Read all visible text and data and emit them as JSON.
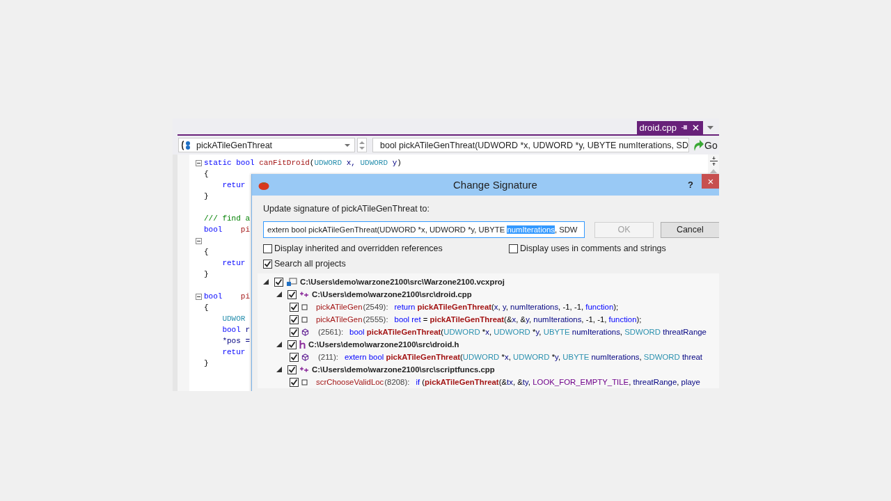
{
  "editor_tab": {
    "label": "droid.cpp",
    "selected": true
  },
  "nav_bar": {
    "scope": "pickATileGenThreat",
    "member": "bool pickATileGenThreat(UDWORD *x, UDWORD *y, UBYTE numIterations, SD",
    "go_button": "Go"
  },
  "code_lines": [
    {
      "fold": true,
      "segments": [
        {
          "text": "static bool ",
          "kind": "kw"
        },
        {
          "text": "canFitDroid",
          "kind": "fn"
        },
        {
          "text": "(",
          "kind": "plain"
        },
        {
          "text": "UDWORD",
          "kind": "type"
        },
        {
          "text": " x, ",
          "kind": "ident"
        },
        {
          "text": "UDWORD",
          "kind": "type"
        },
        {
          "text": " y",
          "kind": "ident"
        },
        {
          "text": ")",
          "kind": "plain"
        }
      ]
    },
    {
      "fold": false,
      "segments": [
        {
          "text": "{",
          "kind": "plain"
        }
      ]
    },
    {
      "fold": false,
      "segments": [
        {
          "text": "    retur",
          "kind": "kw"
        }
      ]
    },
    {
      "fold": false,
      "segments": [
        {
          "text": "}",
          "kind": "plain"
        }
      ]
    },
    {
      "fold": false
    },
    {
      "fold": false,
      "segments": [
        {
          "text": "/// find a",
          "kind": "comment"
        }
      ]
    },
    {
      "fold": false,
      "segments": [
        {
          "text": "bool    ",
          "kind": "kw"
        },
        {
          "text": "pi",
          "kind": "fn"
        }
      ]
    },
    {
      "fold": true
    },
    {
      "fold": false,
      "segments": [
        {
          "text": "{",
          "kind": "plain"
        }
      ]
    },
    {
      "fold": false,
      "segments": [
        {
          "text": "    retur",
          "kind": "kw"
        }
      ]
    },
    {
      "fold": false,
      "segments": [
        {
          "text": "}",
          "kind": "plain"
        }
      ]
    },
    {
      "fold": false
    },
    {
      "fold": true,
      "segments": [
        {
          "text": "bool    ",
          "kind": "kw"
        },
        {
          "text": "pi",
          "kind": "fn"
        }
      ]
    },
    {
      "fold": false,
      "segments": [
        {
          "text": "{",
          "kind": "plain"
        }
      ]
    },
    {
      "fold": false,
      "segments": [
        {
          "text": "    UDWOR",
          "kind": "type"
        }
      ]
    },
    {
      "fold": false,
      "segments": [
        {
          "text": "    bool ",
          "kind": "kw"
        },
        {
          "text": "r",
          "kind": "ident"
        }
      ]
    },
    {
      "fold": false,
      "segments": [
        {
          "text": "    *pos =",
          "kind": "ident"
        }
      ]
    },
    {
      "fold": false,
      "segments": [
        {
          "text": "    retur",
          "kind": "kw"
        }
      ]
    },
    {
      "fold": false,
      "segments": [
        {
          "text": "}",
          "kind": "plain"
        }
      ]
    }
  ],
  "dialog": {
    "title": "Change Signature",
    "help": "?",
    "close": "×",
    "prompt": "Update signature of pickATileGenThreat to:",
    "signature_parts": [
      {
        "text": "extern bool pickATileGenThreat(UDWORD *x, UDWORD *y, UBYTE ",
        "selected": false
      },
      {
        "text": "numIterations",
        "selected": true
      },
      {
        "text": ", SDW",
        "selected": false
      }
    ],
    "ok_button": {
      "label": "OK",
      "disabled": true
    },
    "cancel_button": {
      "label": "Cancel",
      "disabled": false
    },
    "options": [
      {
        "label": "Display inherited and overridden references",
        "checked": false
      },
      {
        "label": "Display uses in comments and strings",
        "checked": false
      },
      {
        "label": "Search all projects",
        "checked": true
      }
    ],
    "tree": [
      {
        "kind": "project",
        "label": "C:\\Users\\demo\\warzone2100\\src\\Warzone2100.vcxproj",
        "expanded": true,
        "checked": true,
        "children": [
          {
            "kind": "cpp",
            "label": "C:\\Users\\demo\\warzone2100\\src\\droid.cpp",
            "expanded": true,
            "checked": true,
            "children": [
              {
                "kind": "method",
                "scope": "pickATileGen",
                "line": "(2549):",
                "checked": true,
                "code": [
                  {
                    "text": "return ",
                    "kind": "kw"
                  },
                  {
                    "text": "pickATileGenThreat",
                    "kind": "call"
                  },
                  {
                    "text": "(",
                    "kind": "plain"
                  },
                  {
                    "text": "x",
                    "kind": "ident"
                  },
                  {
                    "text": ", ",
                    "kind": "plain"
                  },
                  {
                    "text": "y",
                    "kind": "ident"
                  },
                  {
                    "text": ", ",
                    "kind": "plain"
                  },
                  {
                    "text": "numIterations",
                    "kind": "ident"
                  },
                  {
                    "text": ", -1, -1, ",
                    "kind": "plain"
                  },
                  {
                    "text": "function",
                    "kind": "kw"
                  },
                  {
                    "text": ");",
                    "kind": "plain"
                  }
                ]
              },
              {
                "kind": "method",
                "scope": "pickATileGen",
                "line": "(2555):",
                "checked": true,
                "code": [
                  {
                    "text": "bool ",
                    "kind": "kw"
                  },
                  {
                    "text": "ret",
                    "kind": "kw"
                  },
                  {
                    "text": " = ",
                    "kind": "plain"
                  },
                  {
                    "text": "pickATileGenThreat",
                    "kind": "call"
                  },
                  {
                    "text": "(&",
                    "kind": "plain"
                  },
                  {
                    "text": "x",
                    "kind": "ident"
                  },
                  {
                    "text": ", &",
                    "kind": "plain"
                  },
                  {
                    "text": "y",
                    "kind": "ident"
                  },
                  {
                    "text": ", ",
                    "kind": "plain"
                  },
                  {
                    "text": "numIterations",
                    "kind": "ident"
                  },
                  {
                    "text": ", -1, -1, ",
                    "kind": "plain"
                  },
                  {
                    "text": "function",
                    "kind": "kw"
                  },
                  {
                    "text": ");",
                    "kind": "plain"
                  }
                ]
              },
              {
                "kind": "declaration",
                "line": "(2561):",
                "checked": true,
                "code": [
                  {
                    "text": "bool ",
                    "kind": "kw"
                  },
                  {
                    "text": "pickATileGenThreat",
                    "kind": "call"
                  },
                  {
                    "text": "(",
                    "kind": "plain"
                  },
                  {
                    "text": "UDWORD",
                    "kind": "type"
                  },
                  {
                    "text": " *",
                    "kind": "plain"
                  },
                  {
                    "text": "x",
                    "kind": "ident"
                  },
                  {
                    "text": ", ",
                    "kind": "plain"
                  },
                  {
                    "text": "UDWORD",
                    "kind": "type"
                  },
                  {
                    "text": " *",
                    "kind": "plain"
                  },
                  {
                    "text": "y",
                    "kind": "ident"
                  },
                  {
                    "text": ", ",
                    "kind": "plain"
                  },
                  {
                    "text": "UBYTE ",
                    "kind": "type"
                  },
                  {
                    "text": "numIterations",
                    "kind": "ident"
                  },
                  {
                    "text": ", ",
                    "kind": "plain"
                  },
                  {
                    "text": "SDWORD",
                    "kind": "type"
                  },
                  {
                    "text": " threatRange",
                    "kind": "ident"
                  }
                ]
              }
            ]
          },
          {
            "kind": "h",
            "label": "C:\\Users\\demo\\warzone2100\\src\\droid.h",
            "expanded": true,
            "checked": true,
            "children": [
              {
                "kind": "declaration",
                "line": "(211):",
                "checked": true,
                "code": [
                  {
                    "text": "extern bool ",
                    "kind": "kw"
                  },
                  {
                    "text": "pickATileGenThreat",
                    "kind": "call"
                  },
                  {
                    "text": "(",
                    "kind": "plain"
                  },
                  {
                    "text": "UDWORD",
                    "kind": "type"
                  },
                  {
                    "text": " *",
                    "kind": "plain"
                  },
                  {
                    "text": "x",
                    "kind": "ident"
                  },
                  {
                    "text": ", ",
                    "kind": "plain"
                  },
                  {
                    "text": "UDWORD",
                    "kind": "type"
                  },
                  {
                    "text": " *",
                    "kind": "plain"
                  },
                  {
                    "text": "y",
                    "kind": "ident"
                  },
                  {
                    "text": ", ",
                    "kind": "plain"
                  },
                  {
                    "text": "UBYTE ",
                    "kind": "type"
                  },
                  {
                    "text": "numIterations",
                    "kind": "ident"
                  },
                  {
                    "text": ", ",
                    "kind": "plain"
                  },
                  {
                    "text": "SDWORD",
                    "kind": "type"
                  },
                  {
                    "text": " threat",
                    "kind": "ident"
                  }
                ]
              }
            ]
          },
          {
            "kind": "cpp",
            "label": "C:\\Users\\demo\\warzone2100\\src\\scriptfuncs.cpp",
            "expanded": true,
            "checked": true,
            "children": [
              {
                "kind": "method",
                "scope": "scrChooseValidLoc",
                "line": "(8208):",
                "checked": true,
                "code": [
                  {
                    "text": "if ",
                    "kind": "kw"
                  },
                  {
                    "text": "(",
                    "kind": "plain"
                  },
                  {
                    "text": "pickATileGenThreat",
                    "kind": "call"
                  },
                  {
                    "text": "(&",
                    "kind": "plain"
                  },
                  {
                    "text": "tx",
                    "kind": "ident"
                  },
                  {
                    "text": ", &",
                    "kind": "plain"
                  },
                  {
                    "text": "ty",
                    "kind": "ident"
                  },
                  {
                    "text": ", ",
                    "kind": "plain"
                  },
                  {
                    "text": "LOOK_FOR_EMPTY_TILE",
                    "kind": "macro"
                  },
                  {
                    "text": ", ",
                    "kind": "plain"
                  },
                  {
                    "text": "threatRange",
                    "kind": "ident"
                  },
                  {
                    "text": ", ",
                    "kind": "plain"
                  },
                  {
                    "text": "playe",
                    "kind": "ident"
                  }
                ]
              }
            ]
          }
        ]
      }
    ]
  }
}
